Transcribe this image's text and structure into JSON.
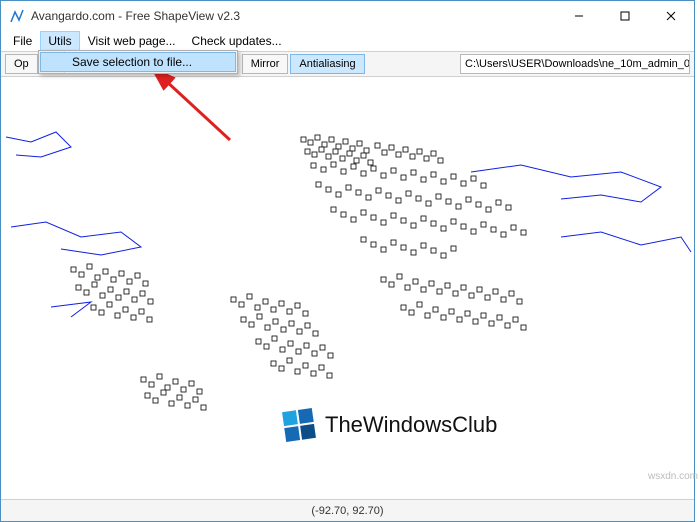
{
  "title": "Avangardo.com - Free ShapeView v2.3",
  "menu": {
    "file": "File",
    "utils": "Utils",
    "visit": "Visit web page...",
    "check": "Check updates..."
  },
  "utils_menu": {
    "save_selection": "Save selection to file..."
  },
  "toolbar": {
    "open_partial": "Op",
    "mirror": "Mirror",
    "antialias": "Antialiasing",
    "path": "C:\\Users\\USER\\Downloads\\ne_10m_admin_0_bound"
  },
  "status": {
    "coords": "(-92.70, 92.70)"
  },
  "watermark": {
    "brand": "TheWindowsClub",
    "site": "wsxdn.com"
  }
}
